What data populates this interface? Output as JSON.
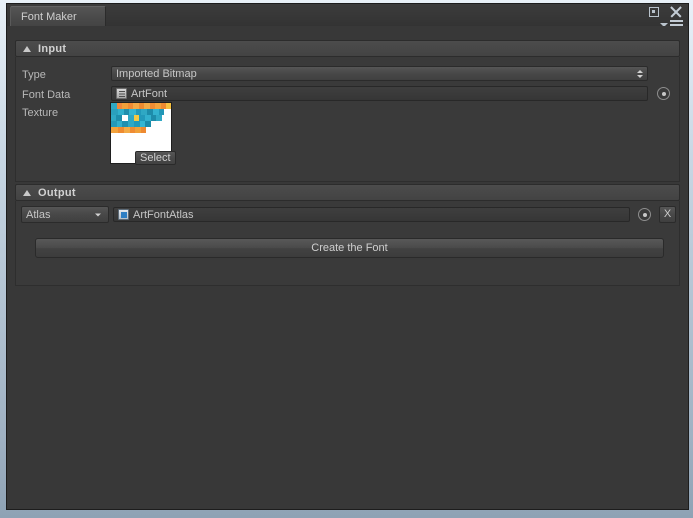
{
  "window": {
    "tab_label": "Font Maker",
    "maximize_icon": "maximize-icon",
    "close_icon": "close-icon",
    "menu_icon": "hamburger-menu-icon"
  },
  "input_section": {
    "title": "Input",
    "foldout_icon": "triangle-down-icon",
    "rows": {
      "type": {
        "label": "Type",
        "value": "Imported Bitmap",
        "control": "dropdown"
      },
      "font_data": {
        "label": "Font Data",
        "value": "ArtFont",
        "asset_icon": "text-asset-icon",
        "picker_icon": "object-picker-icon"
      },
      "texture": {
        "label": "Texture",
        "select_label": "Select",
        "thumbnail_icon": "texture-thumbnail"
      }
    }
  },
  "output_section": {
    "title": "Output",
    "foldout_icon": "triangle-down-icon",
    "atlas_dropdown": "Atlas",
    "atlas_value": "ArtFontAtlas",
    "atlas_asset_icon": "prefab-asset-icon",
    "picker_icon": "object-picker-icon",
    "clear_label": "X"
  },
  "actions": {
    "create_font_label": "Create the Font"
  },
  "colors": {
    "window_bg": "#383838",
    "panel_bg": "#3a3a3a",
    "header_bg": "#4c4c4c",
    "text": "#c6c6c6",
    "label_text": "#b8b8b8",
    "frame": "#c8d7e4"
  },
  "texture_art": {
    "rows": [
      {
        "y": 0,
        "cells": [
          {
            "x": 0,
            "w": 6,
            "c": "#2fa8c4"
          },
          {
            "x": 6,
            "w": 5,
            "c": "#f0873a"
          },
          {
            "x": 11,
            "w": 6,
            "c": "#f0a03a"
          },
          {
            "x": 17,
            "w": 5,
            "c": "#ef8a33"
          },
          {
            "x": 22,
            "w": 6,
            "c": "#f2a845"
          },
          {
            "x": 28,
            "w": 5,
            "c": "#ee8b30"
          },
          {
            "x": 33,
            "w": 6,
            "c": "#f3ab46"
          },
          {
            "x": 39,
            "w": 5,
            "c": "#ef8c33"
          },
          {
            "x": 44,
            "w": 6,
            "c": "#f2a23c"
          },
          {
            "x": 50,
            "w": 5,
            "c": "#ee8a31"
          },
          {
            "x": 55,
            "w": 7,
            "c": "#f7c13f"
          }
        ]
      },
      {
        "y": 6,
        "cells": [
          {
            "x": 0,
            "w": 7,
            "c": "#2aa0bd"
          },
          {
            "x": 7,
            "w": 6,
            "c": "#31b0cc"
          },
          {
            "x": 13,
            "w": 5,
            "c": "#1f8fae"
          },
          {
            "x": 18,
            "w": 7,
            "c": "#35b6d2"
          },
          {
            "x": 25,
            "w": 5,
            "c": "#2299ba"
          },
          {
            "x": 30,
            "w": 6,
            "c": "#2fa8c4"
          },
          {
            "x": 36,
            "w": 6,
            "c": "#1d8caa"
          },
          {
            "x": 42,
            "w": 6,
            "c": "#33b2cf"
          },
          {
            "x": 48,
            "w": 5,
            "c": "#2297b7"
          },
          {
            "x": 53,
            "w": 9,
            "c": "#ffffff"
          }
        ]
      },
      {
        "y": 12,
        "cells": [
          {
            "x": 0,
            "w": 5,
            "c": "#2fa8c4"
          },
          {
            "x": 5,
            "w": 6,
            "c": "#1e8eac"
          },
          {
            "x": 11,
            "w": 6,
            "c": "#ffffff"
          },
          {
            "x": 17,
            "w": 6,
            "c": "#2fa8c4"
          },
          {
            "x": 23,
            "w": 5,
            "c": "#f5c944"
          },
          {
            "x": 28,
            "w": 6,
            "c": "#2299ba"
          },
          {
            "x": 34,
            "w": 6,
            "c": "#32b0ce"
          },
          {
            "x": 40,
            "w": 5,
            "c": "#1d8caa"
          },
          {
            "x": 45,
            "w": 6,
            "c": "#2fa8c4"
          },
          {
            "x": 51,
            "w": 11,
            "c": "#ffffff"
          }
        ]
      },
      {
        "y": 18,
        "cells": [
          {
            "x": 0,
            "w": 6,
            "c": "#2399b9"
          },
          {
            "x": 6,
            "w": 5,
            "c": "#31aecb"
          },
          {
            "x": 11,
            "w": 6,
            "c": "#1f90af"
          },
          {
            "x": 17,
            "w": 6,
            "c": "#2fa8c4"
          },
          {
            "x": 23,
            "w": 6,
            "c": "#2299ba"
          },
          {
            "x": 29,
            "w": 5,
            "c": "#35b6d2"
          },
          {
            "x": 34,
            "w": 6,
            "c": "#1d8caa"
          },
          {
            "x": 40,
            "w": 22,
            "c": "#ffffff"
          }
        ]
      },
      {
        "y": 24,
        "cells": [
          {
            "x": 0,
            "w": 7,
            "c": "#f2a23c"
          },
          {
            "x": 7,
            "w": 6,
            "c": "#ee8b30"
          },
          {
            "x": 13,
            "w": 6,
            "c": "#f3ab46"
          },
          {
            "x": 19,
            "w": 5,
            "c": "#ef8c33"
          },
          {
            "x": 24,
            "w": 6,
            "c": "#f0a03a"
          },
          {
            "x": 30,
            "w": 5,
            "c": "#ee8a31"
          },
          {
            "x": 35,
            "w": 27,
            "c": "#ffffff"
          }
        ]
      }
    ]
  }
}
